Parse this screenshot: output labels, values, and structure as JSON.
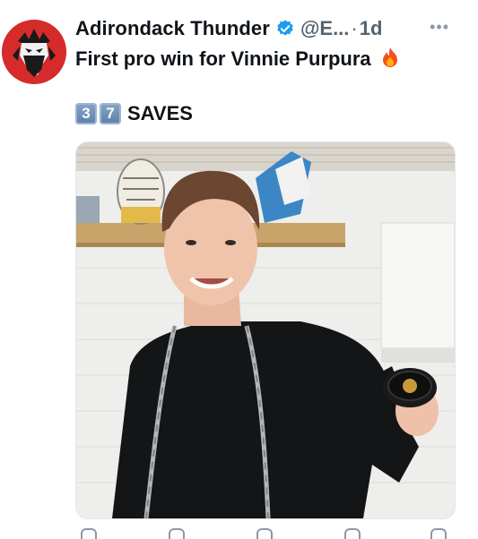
{
  "tweet": {
    "display_name": "Adirondack Thunder",
    "handle": "@E...",
    "separator": "·",
    "time": "1d",
    "more_label": "•••",
    "text_line1": "First pro win for Vinnie Purpura",
    "keycaps": [
      "3",
      "7"
    ],
    "text_line2": "SAVES"
  },
  "colors": {
    "verified": "#1d9bf0",
    "avatar_bg": "#d62b2b",
    "secondary_text": "#536471"
  },
  "icons": {
    "verified": "verified-badge-icon",
    "fire": "fire-emoji-icon",
    "more": "more-options-icon",
    "avatar": "thunder-logo-avatar"
  }
}
